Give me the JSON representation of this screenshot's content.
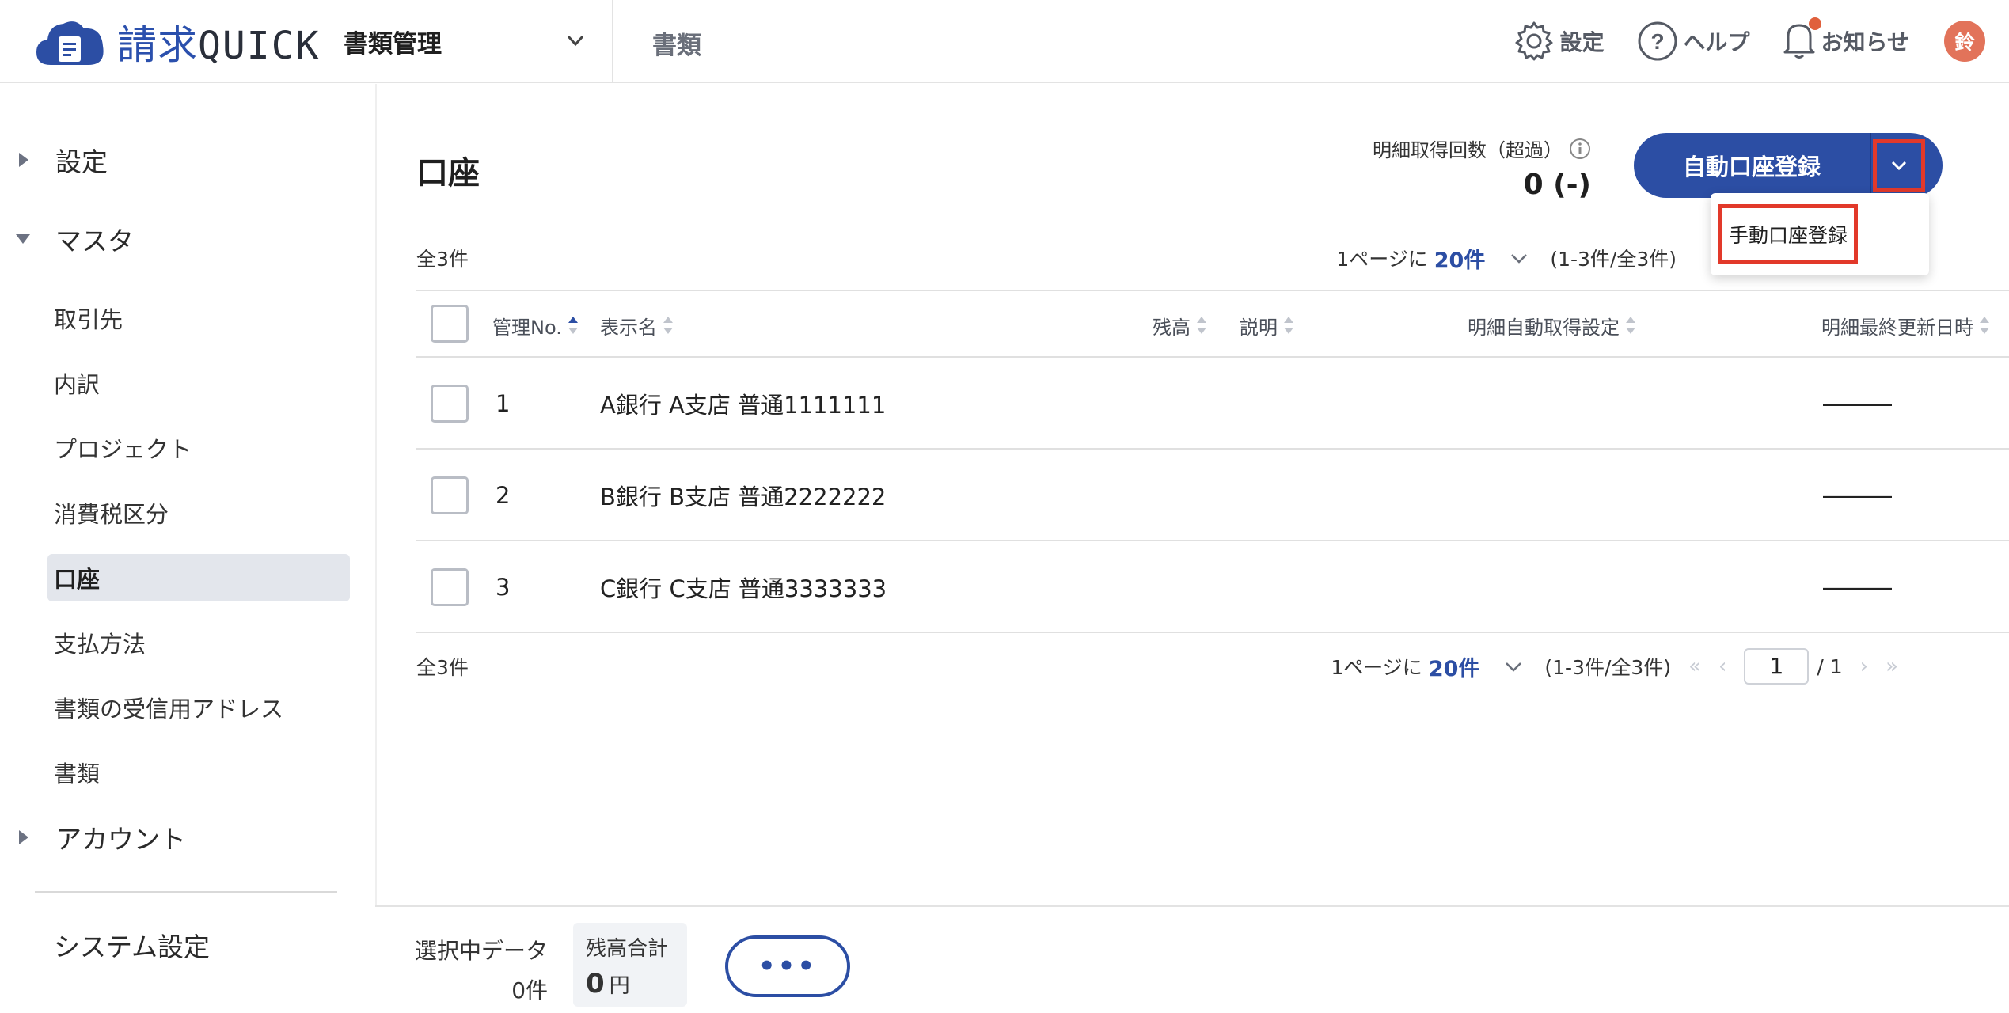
{
  "header": {
    "logo_text": "請求",
    "logo_text_latin": "QUICK",
    "module": "書類管理",
    "breadcrumb": "書類",
    "settings_label": "設定",
    "help_label": "ヘルプ",
    "notifications_label": "お知らせ",
    "avatar_initial": "鈴"
  },
  "sidebar": {
    "settings_group": "設定",
    "master_group": "マスタ",
    "items": [
      "取引先",
      "内訳",
      "プロジェクト",
      "消費税区分",
      "口座",
      "支払方法",
      "書類の受信用アドレス",
      "書類"
    ],
    "active_item": "口座",
    "account_group": "アカウント",
    "system_settings": "システム設定"
  },
  "main": {
    "title": "口座",
    "quota_label": "明細取得回数（超過）",
    "quota_value": "0 (-)",
    "primary_button": "自動口座登録",
    "dropdown_option": "手動口座登録",
    "total_count": "全3件",
    "per_page_prefix": "1ページに",
    "per_page_value": "20件",
    "range_text": "(1-3件/全3件)",
    "current_page": "1",
    "page_total": "/ 1"
  },
  "table": {
    "headers": {
      "no": "管理No.",
      "name": "表示名",
      "balance": "残高",
      "description": "説明",
      "auto_fetch": "明細自動取得設定",
      "last_updated": "明細最終更新日時"
    },
    "rows": [
      {
        "no": "1",
        "name": "A銀行 A支店 普通1111111",
        "last_updated": "―――"
      },
      {
        "no": "2",
        "name": "B銀行 B支店 普通2222222",
        "last_updated": "―――"
      },
      {
        "no": "3",
        "name": "C銀行 C支店 普通3333333",
        "last_updated": "―――"
      }
    ]
  },
  "bottom": {
    "selected_label": "選択中データ",
    "selected_value": "0件",
    "balance_label": "残高合計",
    "balance_amount": "0",
    "balance_unit": "円",
    "more_label": "•••"
  },
  "colors": {
    "accent": "#2c4ea4",
    "highlight": "#e2392a",
    "avatar": "#e2735a"
  }
}
